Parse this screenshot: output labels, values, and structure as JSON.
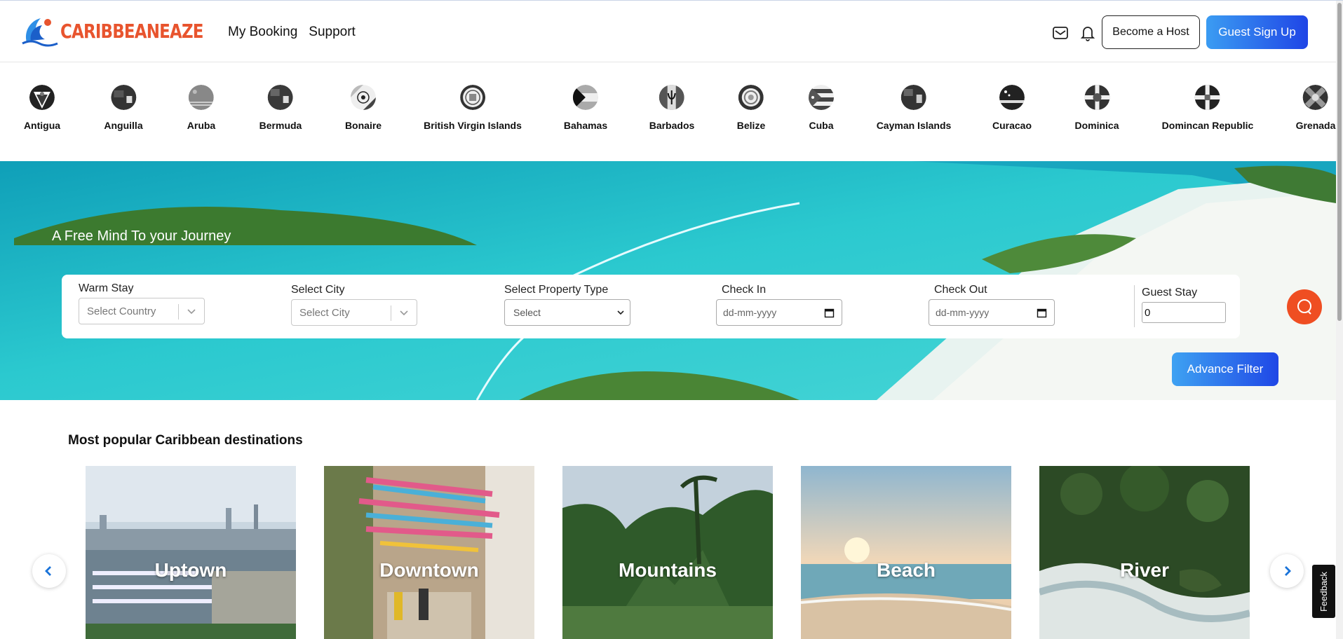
{
  "brand": {
    "name": "CARIBBEANEAZE",
    "logo_icon": "wave-logo-icon"
  },
  "nav": {
    "my_booking": "My Booking",
    "support": "Support"
  },
  "header_actions": {
    "mail_icon": "mail-icon",
    "bell_icon": "bell-icon",
    "become_host": "Become a Host",
    "guest_signup": "Guest Sign Up"
  },
  "countries": [
    {
      "name": "Antigua"
    },
    {
      "name": "Anguilla"
    },
    {
      "name": "Aruba"
    },
    {
      "name": "Bermuda"
    },
    {
      "name": "Bonaire"
    },
    {
      "name": "British Virgin Islands"
    },
    {
      "name": "Bahamas"
    },
    {
      "name": "Barbados"
    },
    {
      "name": "Belize"
    },
    {
      "name": "Cuba"
    },
    {
      "name": "Cayman Islands"
    },
    {
      "name": "Curacao"
    },
    {
      "name": "Dominica"
    },
    {
      "name": "Domincan Republic"
    },
    {
      "name": "Grenada"
    }
  ],
  "hero": {
    "tagline": "A Free Mind To your Journey",
    "search": {
      "warm_stay": {
        "label": "Warm Stay",
        "placeholder": "Select Country"
      },
      "city": {
        "label": "Select City",
        "placeholder": "Select City"
      },
      "property": {
        "label": "Select Property Type",
        "value": "Select"
      },
      "check_in": {
        "label": "Check In",
        "placeholder": "dd-mm-yyyy"
      },
      "check_out": {
        "label": "Check Out",
        "placeholder": "dd-mm-yyyy"
      },
      "guest": {
        "label": "Guest Stay",
        "value": "0"
      }
    },
    "advance_filter": "Advance Filter",
    "chat_icon": "search-chat-icon"
  },
  "popular": {
    "title": "Most popular Caribbean destinations",
    "items": [
      {
        "label": "Uptown"
      },
      {
        "label": "Downtown"
      },
      {
        "label": "Mountains"
      },
      {
        "label": "Beach"
      },
      {
        "label": "River"
      }
    ],
    "prev_icon": "chevron-left-icon",
    "next_icon": "chevron-right-icon"
  },
  "feedback": "Feedback",
  "colors": {
    "brand": "#e8542e",
    "primary_blue": "#1f45e6",
    "chat_orange": "#ef4e22"
  }
}
